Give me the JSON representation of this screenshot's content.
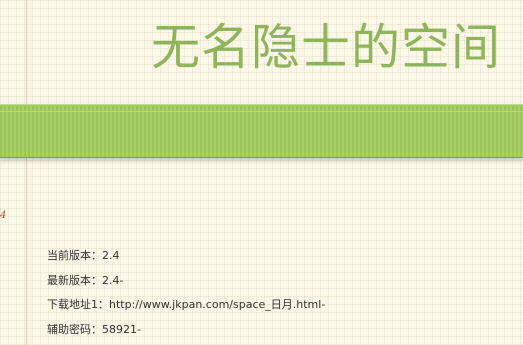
{
  "site_title": "无名隐士的空间",
  "margin_mark": "4",
  "info": [
    {
      "label": "当前版本：",
      "value": "2.4"
    },
    {
      "label": "最新版本：",
      "value": "2.4-"
    },
    {
      "label": "下载地址1：",
      "value": "http://www.jkpan.com/space_日月.html-"
    },
    {
      "label": "辅助密码：",
      "value": "58921-"
    }
  ],
  "colors": {
    "accent_green": "#9cc55c",
    "title_green": "#8fb55b",
    "paper": "#fbf8ea"
  }
}
